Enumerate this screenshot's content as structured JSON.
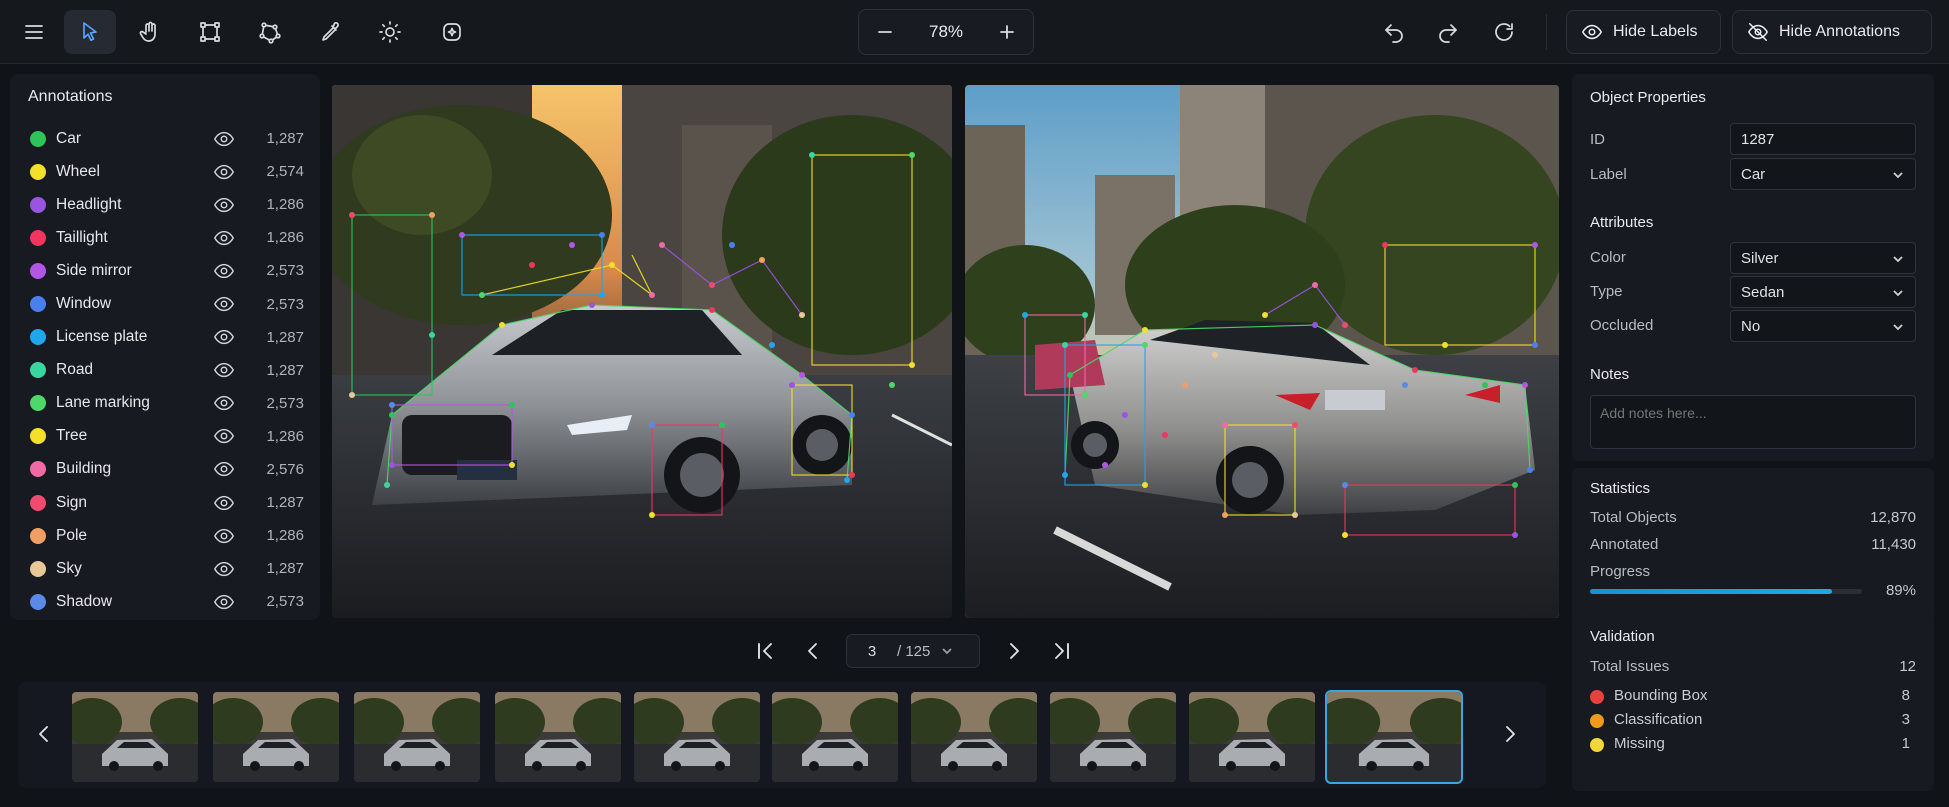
{
  "toolbar": {
    "tools": [
      {
        "name": "menu",
        "icon": "menu-icon"
      },
      {
        "name": "select",
        "icon": "cursor-arrow-icon",
        "active": true
      },
      {
        "name": "pan",
        "icon": "hand-icon"
      },
      {
        "name": "bounding-box",
        "icon": "bounding-box-icon"
      },
      {
        "name": "polygon",
        "icon": "polygon-icon"
      },
      {
        "name": "eyedropper",
        "icon": "eyedropper-icon"
      },
      {
        "name": "brightness",
        "icon": "sun-icon"
      },
      {
        "name": "magic-box",
        "icon": "sparkle-box-icon"
      }
    ],
    "zoom": "78%",
    "hide_labels": "Hide Labels",
    "hide_annotations": "Hide Annotations"
  },
  "annotations": {
    "title": "Annotations",
    "items": [
      {
        "label": "Car",
        "count": "1,287",
        "color": "#2fc45a"
      },
      {
        "label": "Wheel",
        "count": "2,574",
        "color": "#f2e02c"
      },
      {
        "label": "Headlight",
        "count": "1,286",
        "color": "#9a55e0"
      },
      {
        "label": "Taillight",
        "count": "1,286",
        "color": "#f0365f"
      },
      {
        "label": "Side mirror",
        "count": "2,573",
        "color": "#b256e8"
      },
      {
        "label": "Window",
        "count": "2,573",
        "color": "#4a7ff0"
      },
      {
        "label": "License plate",
        "count": "1,287",
        "color": "#1ea6ee"
      },
      {
        "label": "Road",
        "count": "1,287",
        "color": "#3ad6a0"
      },
      {
        "label": "Lane marking",
        "count": "2,573",
        "color": "#4ed86a"
      },
      {
        "label": "Tree",
        "count": "1,286",
        "color": "#f3df2c"
      },
      {
        "label": "Building",
        "count": "2,576",
        "color": "#f06aa6"
      },
      {
        "label": "Sign",
        "count": "1,287",
        "color": "#f24a6e"
      },
      {
        "label": "Pole",
        "count": "1,286",
        "color": "#f0a064"
      },
      {
        "label": "Sky",
        "count": "1,287",
        "color": "#e8c896"
      },
      {
        "label": "Shadow",
        "count": "2,573",
        "color": "#5b8ae6"
      }
    ]
  },
  "pager": {
    "current": "3",
    "total": "/ 125"
  },
  "filmstrip": {
    "thumb_count": 10,
    "selected_index": 9
  },
  "properties": {
    "title": "Object Properties",
    "id_label": "ID",
    "id_value": "1287",
    "label_label": "Label",
    "label_value": "Car",
    "attributes_title": "Attributes",
    "color_label": "Color",
    "color_value": "Silver",
    "type_label": "Type",
    "type_value": "Sedan",
    "occluded_label": "Occluded",
    "occluded_value": "No",
    "notes_title": "Notes",
    "notes_placeholder": "Add notes here..."
  },
  "statistics": {
    "title": "Statistics",
    "total_label": "Total Objects",
    "total_value": "12,870",
    "annotated_label": "Annotated",
    "annotated_value": "11,430",
    "progress_label": "Progress",
    "progress_value": "89%",
    "progress_fraction": 0.89
  },
  "validation": {
    "title": "Validation",
    "total_label": "Total Issues",
    "total_value": "12",
    "items": [
      {
        "label": "Bounding Box",
        "value": "8",
        "color": "#e8413d"
      },
      {
        "label": "Classification",
        "value": "3",
        "color": "#f09a1a"
      },
      {
        "label": "Missing",
        "value": "1",
        "color": "#f0d83a"
      }
    ]
  },
  "colors": {
    "accent": "#3d8bff",
    "progress": "#1b9ae0",
    "selected_thumb": "#3aa6d9"
  }
}
